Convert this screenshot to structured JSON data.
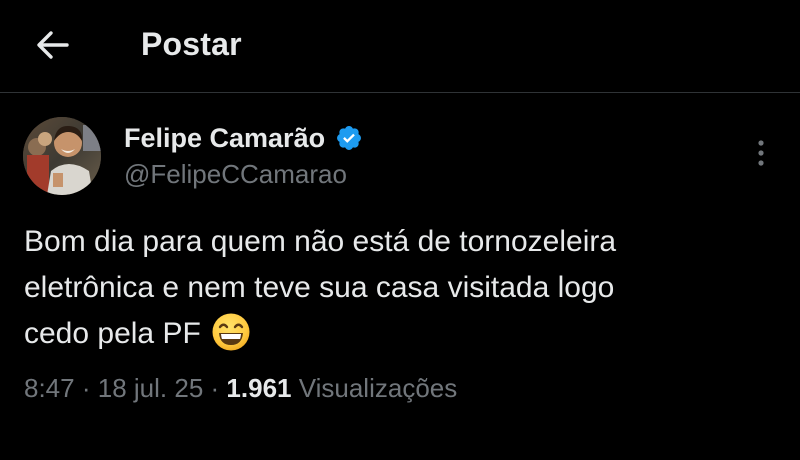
{
  "header": {
    "title": "Postar",
    "back_icon": "arrow-left-icon"
  },
  "tweet": {
    "author": {
      "name": "Felipe Camarão",
      "handle": "@FelipeCCamarao",
      "verified": true,
      "verified_color": "#1d9bf0"
    },
    "text_lines": [
      "Bom dia para quem não está de tornozeleira",
      "eletrônica e nem teve sua casa visitada logo",
      "cedo pela PF"
    ],
    "emoji": "grinning-face-icon",
    "time": "8:47",
    "date": "18 jul. 25",
    "separator": "·",
    "views_count": "1.961",
    "views_label": "Visualizações"
  },
  "colors": {
    "background": "#000000",
    "primary_text": "#e7e9ea",
    "secondary_text": "#71767b",
    "divider": "#2f3336"
  }
}
